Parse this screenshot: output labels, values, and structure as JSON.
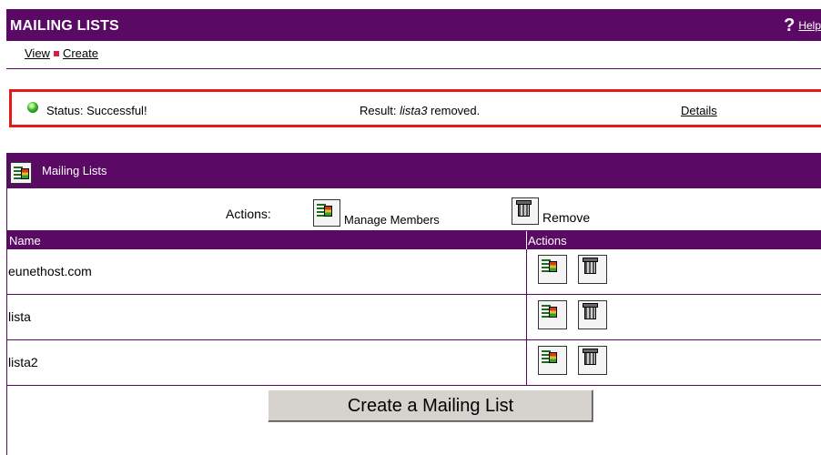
{
  "header": {
    "title": "MAILING LISTS",
    "help_label": "Help"
  },
  "subnav": {
    "view": "View",
    "create": "Create"
  },
  "status": {
    "status_text": "Status: Successful!",
    "result_prefix": "Result: ",
    "result_item": "lista3",
    "result_suffix": " removed.",
    "details": "Details"
  },
  "panel": {
    "title": "Mailing Lists",
    "actions_label": "Actions:",
    "manage_members": "Manage Members",
    "remove": "Remove",
    "columns": [
      "Name",
      "Actions"
    ],
    "rows": [
      {
        "name": "eunethost.com"
      },
      {
        "name": "lista"
      },
      {
        "name": "lista2"
      }
    ],
    "create_button": "Create a Mailing List"
  },
  "colors": {
    "brand": "#5a0a65",
    "alert_border": "#e41a1a",
    "success": "#36b228"
  },
  "icons": [
    "help-icon",
    "status-success-icon",
    "manage-members-icon",
    "remove-icon"
  ]
}
